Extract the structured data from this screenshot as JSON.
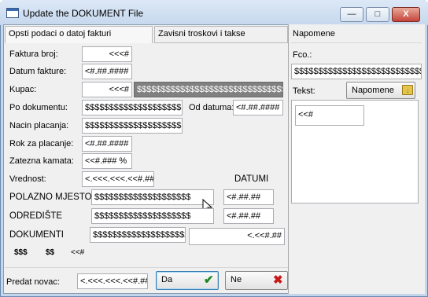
{
  "window": {
    "title": "Update the DOKUMENT File"
  },
  "title_buttons": {
    "minimize": "—",
    "maximize": "□",
    "close": "X"
  },
  "tabs": [
    {
      "label": "Opsti podaci o datoj fakturi"
    },
    {
      "label": "Zavisni troskovi i takse"
    }
  ],
  "form": {
    "faktura_broj": {
      "label": "Faktura broj:",
      "value": "<<<#"
    },
    "datum_fakture": {
      "label": "Datum fakture:",
      "value": "<#.##.####"
    },
    "kupac": {
      "label": "Kupac:",
      "value": "<<<#",
      "name_value": "$$$$$$$$$$$$$$$$$$$$$$$$$$$$$$$$$$$"
    },
    "po_dokumentu": {
      "label": "Po dokumentu:",
      "value": "$$$$$$$$$$$$$$$$$$$$",
      "od_datuma_label": "Od datuma:",
      "od_datuma_value": "<#.##.####"
    },
    "nacin_placanja": {
      "label": "Nacin placanja:",
      "value": "$$$$$$$$$$$$$$$$$$$$"
    },
    "rok_za_placanje": {
      "label": "Rok za placanje:",
      "value": "<#.##.####"
    },
    "zatezna_kamata": {
      "label": "Zatezna kamata:",
      "value": "<<#.### %"
    },
    "vrednost": {
      "label": "Vrednost:",
      "value": "<.<<<.<<<.<<#.##"
    },
    "datumi_header": "DATUMI",
    "polazno_mjesto": {
      "label": "POLAZNO MJESTO",
      "value": "$$$$$$$$$$$$$$$$$$$$",
      "date": "<#.##.##"
    },
    "odrediste": {
      "label": "ODREDIŠTE",
      "value": "$$$$$$$$$$$$$$$$$$$$",
      "date": "<#.##.##"
    },
    "dokumenti": {
      "label": "DOKUMENTI",
      "value": "$$$$$$$$$$$$$$$$$$$$",
      "amount": "<.<<#.##"
    },
    "footer_tags": [
      "$$$",
      "$$",
      "<<#"
    ],
    "predat_novac": {
      "label": "Predat novac:",
      "value": "<.<<<.<<<.<<#.##"
    }
  },
  "buttons": {
    "da": "Da",
    "ne": "Ne"
  },
  "notes": {
    "header": "Napomene",
    "fco_label": "Fco.:",
    "fco_value": "$$$$$$$$$$$$$$$$$$$$$$$$$$$$$$$$$$$$$$$$$$$",
    "tekst_label": "Tekst:",
    "napomene_button": "Napomene",
    "memo_value": "<<#"
  }
}
